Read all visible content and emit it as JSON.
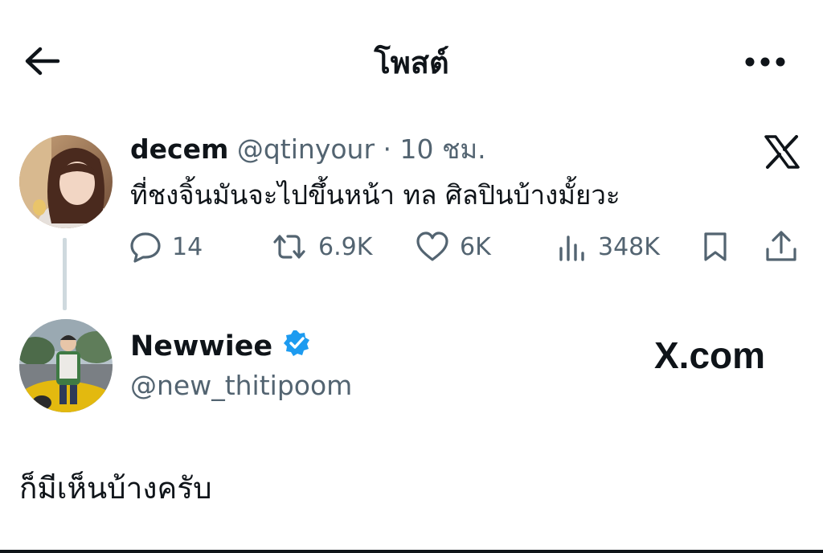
{
  "header": {
    "title": "โพสต์",
    "back_icon": "arrow-left-icon",
    "more_icon": "more-horizontal-icon"
  },
  "quoted_tweet": {
    "display_name": "decem",
    "handle": "@qtinyour",
    "separator": "·",
    "time": "10 ชม.",
    "text": "ที่ชงจิ้นมันจะไปขึ้นหน้า ทล ศิลปินบ้างมั้ยวะ",
    "platform_icon": "x-logo-icon",
    "actions": {
      "replies": "14",
      "reposts": "6.9K",
      "likes": "6K",
      "views": "348K"
    }
  },
  "reply_tweet": {
    "display_name": "Newwiee",
    "handle": "@new_thitipoom",
    "verified": true,
    "verified_color": "#1d9bf0",
    "watermark": "X.com",
    "text": "ก็มีเห็นบ้างครับ"
  },
  "colors": {
    "text": "#0f1419",
    "secondary": "#536471",
    "thread_line": "#cfd9de",
    "verified": "#1d9bf0"
  }
}
